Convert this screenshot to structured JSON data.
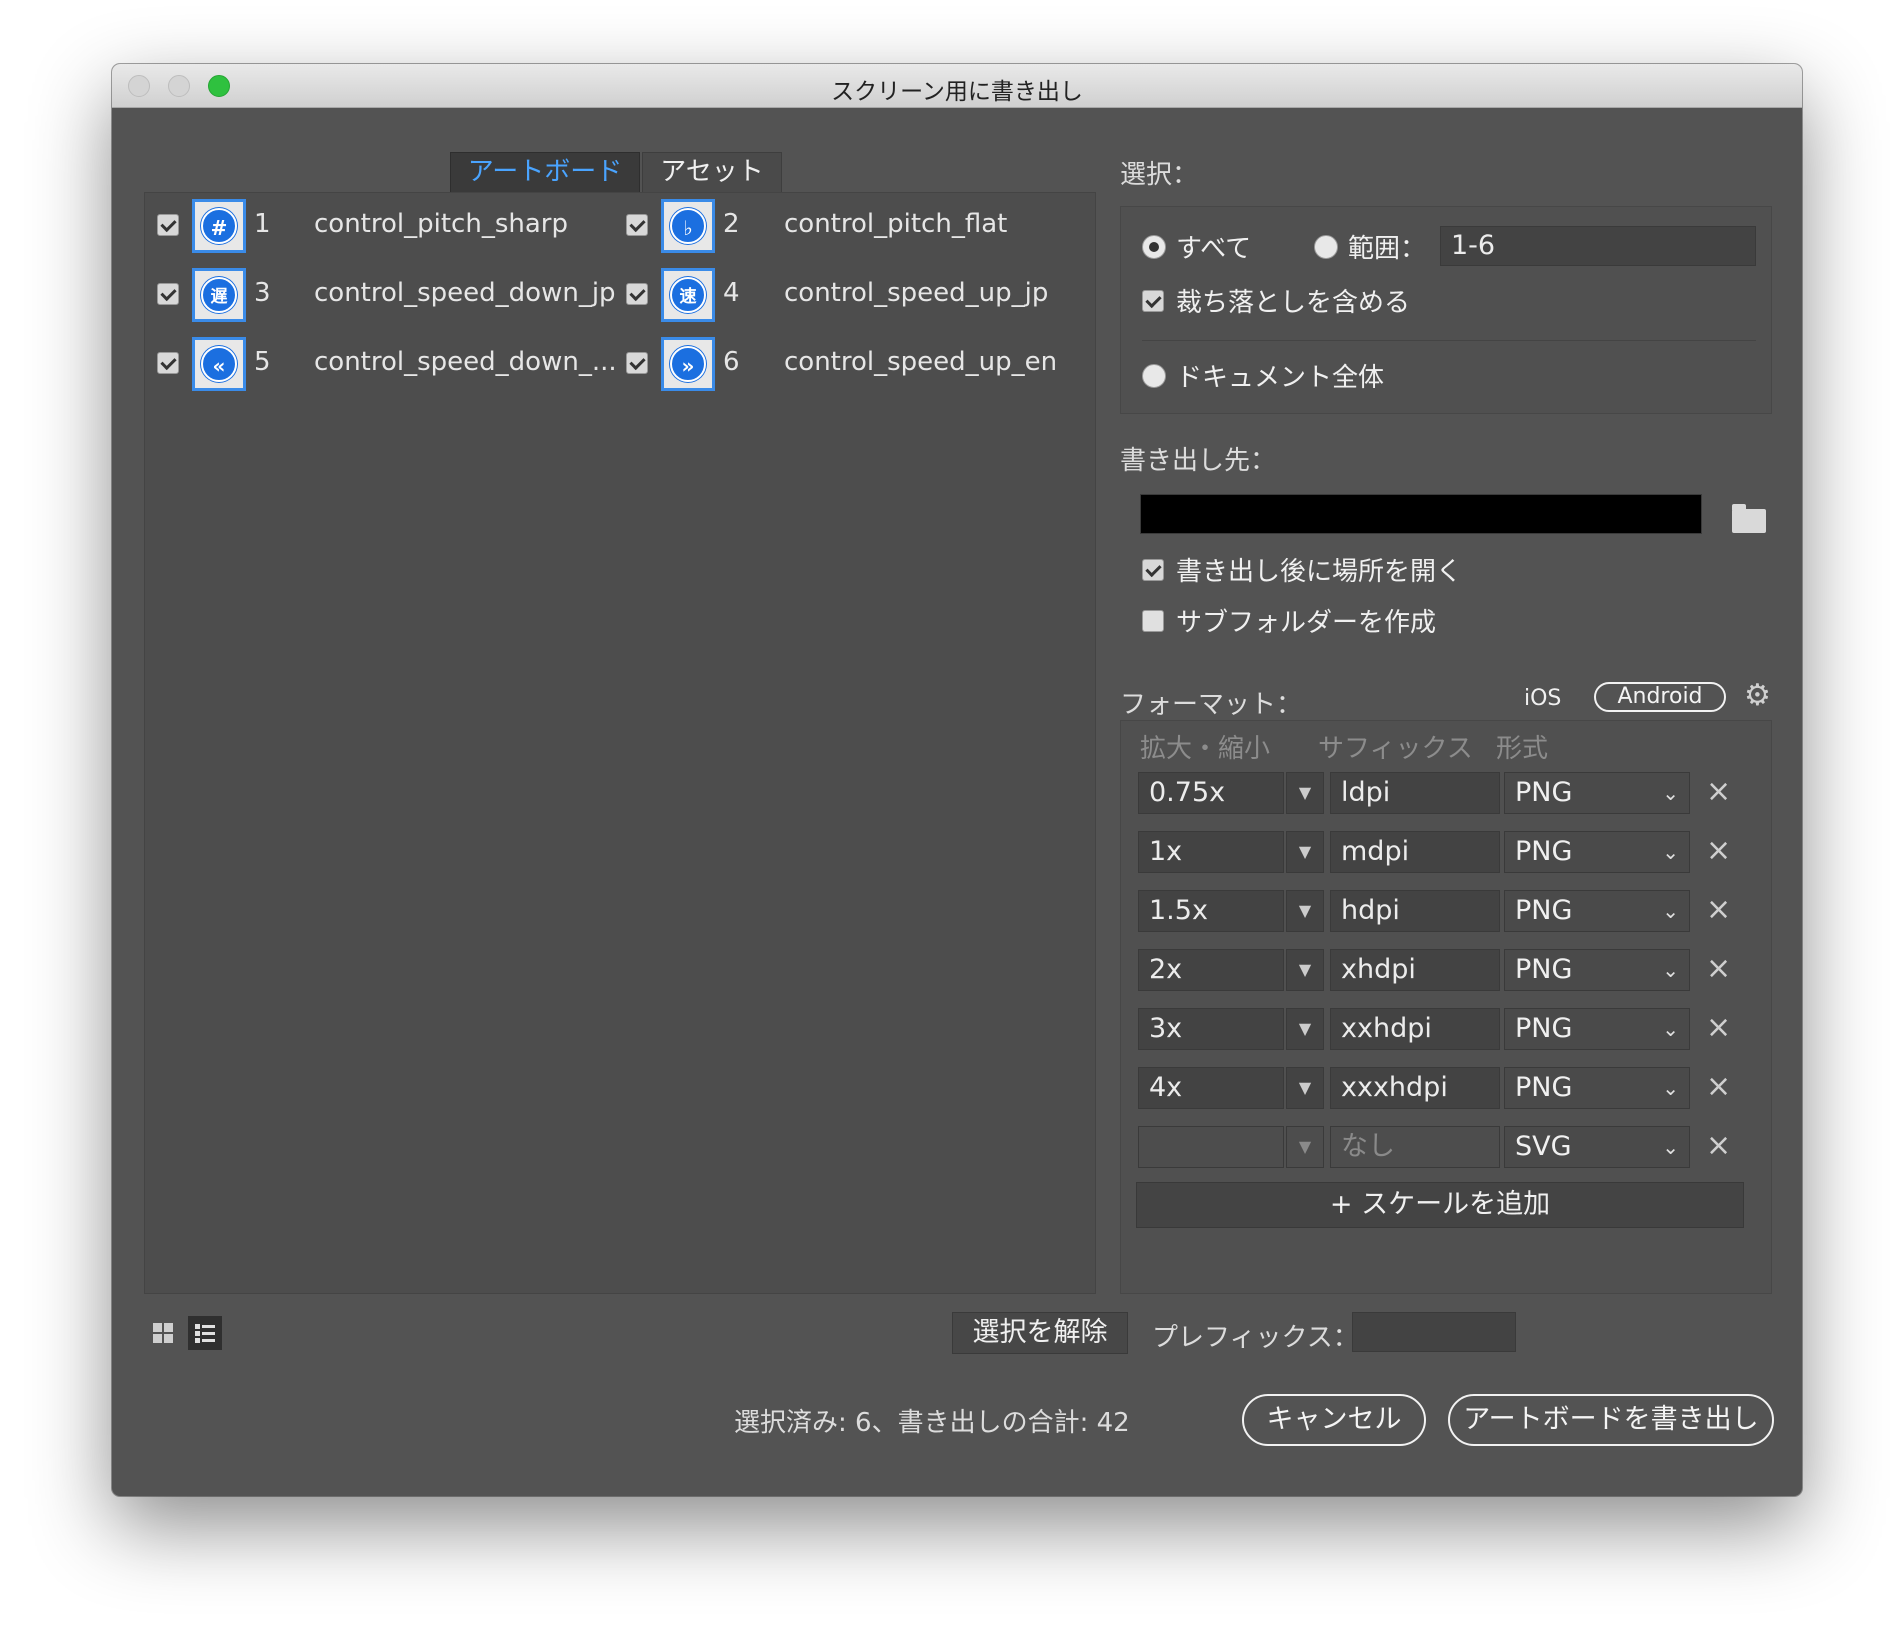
{
  "window": {
    "title": "スクリーン用に書き出し"
  },
  "tabs": [
    {
      "label": "アートボード",
      "active": true
    },
    {
      "label": "アセット",
      "active": false
    }
  ],
  "artboards": [
    {
      "num": "1",
      "name": "control_pitch_sharp",
      "glyph": "#",
      "checked": true
    },
    {
      "num": "2",
      "name": "control_pitch_flat",
      "glyph": "♭",
      "checked": true
    },
    {
      "num": "3",
      "name": "control_speed_down_jp",
      "glyph": "遅",
      "checked": true
    },
    {
      "num": "4",
      "name": "control_speed_up_jp",
      "glyph": "速",
      "checked": true
    },
    {
      "num": "5",
      "name": "control_speed_down_...",
      "glyph": "«",
      "checked": true
    },
    {
      "num": "6",
      "name": "control_speed_up_en",
      "glyph": "»",
      "checked": true
    }
  ],
  "selection": {
    "header": "選択：",
    "all_label": "すべて",
    "range_label": "範囲：",
    "range_value": "1-6",
    "bleed_label": "裁ち落としを含める",
    "whole_doc_label": "ドキュメント全体"
  },
  "export_to": {
    "header": "書き出し先：",
    "path": "",
    "open_after_label": "書き出し後に場所を開く",
    "subfolder_label": "サブフォルダーを作成"
  },
  "formats": {
    "header": "フォーマット：",
    "ios_label": "iOS",
    "android_label": "Android",
    "col_scale": "拡大・縮小",
    "col_suffix": "サフィックス",
    "col_format": "形式",
    "rows": [
      {
        "scale": "0.75x",
        "suffix": "ldpi",
        "format": "PNG"
      },
      {
        "scale": "1x",
        "suffix": "mdpi",
        "format": "PNG"
      },
      {
        "scale": "1.5x",
        "suffix": "hdpi",
        "format": "PNG"
      },
      {
        "scale": "2x",
        "suffix": "xhdpi",
        "format": "PNG"
      },
      {
        "scale": "3x",
        "suffix": "xxhdpi",
        "format": "PNG"
      },
      {
        "scale": "4x",
        "suffix": "xxxhdpi",
        "format": "PNG"
      },
      {
        "scale": "",
        "suffix": "なし",
        "format": "SVG"
      }
    ],
    "add_scale_label": "+ スケールを追加"
  },
  "bottom": {
    "deselect_label": "選択を解除",
    "prefix_label": "プレフィックス：",
    "prefix_value": "",
    "status": "選択済み: 6、書き出しの合計: 42",
    "cancel_label": "キャンセル",
    "export_label": "アートボードを書き出し"
  },
  "icons": {
    "close": "close-dot",
    "minimize": "minimize-dot",
    "zoom": "zoom-dot"
  }
}
